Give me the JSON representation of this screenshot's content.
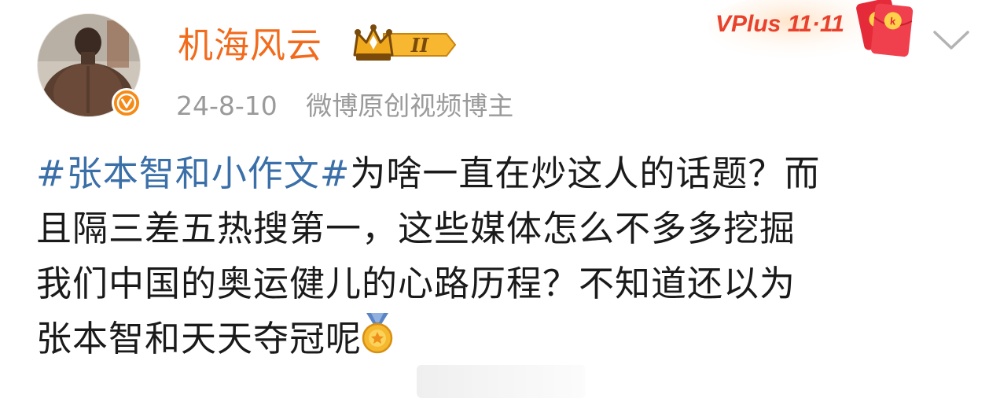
{
  "user": {
    "name": "机海风云",
    "level_badge": "II",
    "date": "24-8-10",
    "title": "微博原创视频博主"
  },
  "promo": {
    "text": "VPlus 11·11"
  },
  "post": {
    "hashtag": "#张本智和小作文#",
    "line1_rest": "为啥一直在炒这人的话题？而",
    "line2": "且隔三差五热搜第一，这些媒体怎么不多多挖掘",
    "line3": "我们中国的奥运健儿的心路历程？不知道还以为",
    "line4": "张本智和天天夺冠呢"
  },
  "colors": {
    "username": "#f26b1d",
    "hashtag": "#3a6fa8",
    "meta": "#9a9a9a",
    "text": "#1a1a1a"
  },
  "icons": {
    "verified": "orange-verified-v-icon",
    "vip": "crown-vip-level-icon",
    "chevron": "chevron-down-icon",
    "medal": "gold-medal-emoji-icon"
  }
}
